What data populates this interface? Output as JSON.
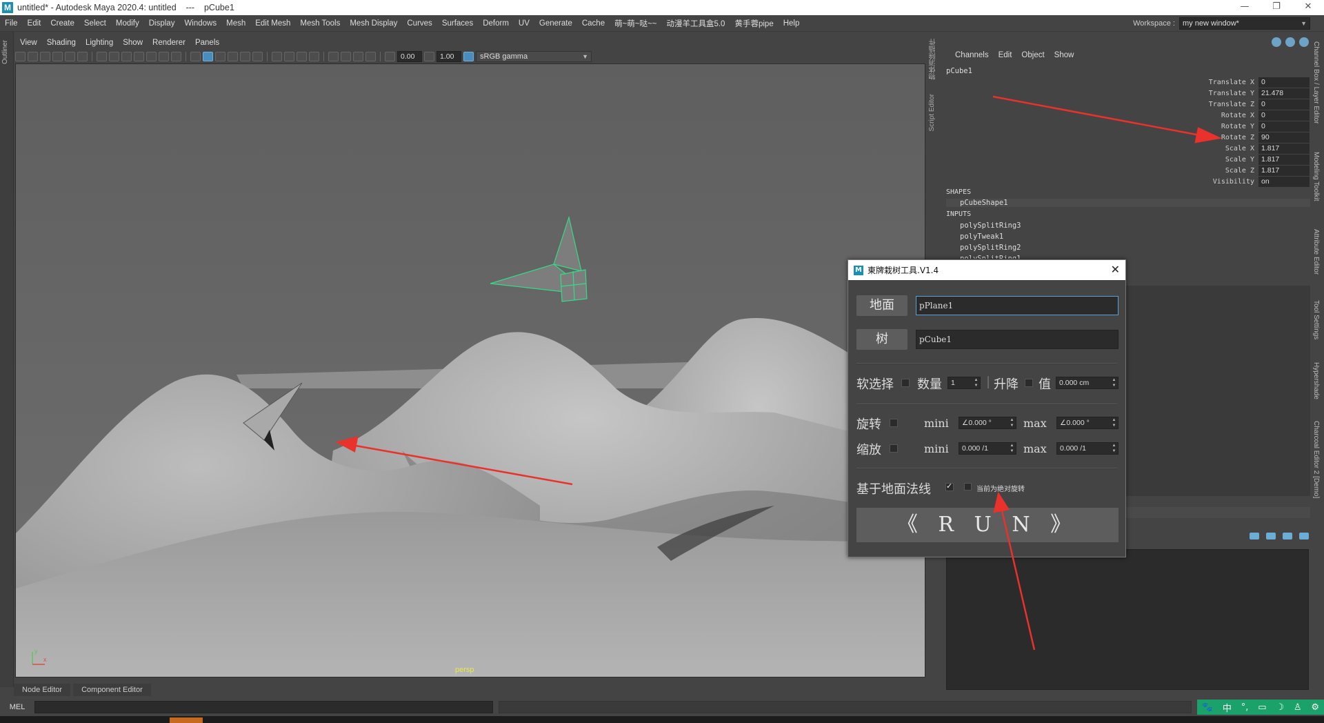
{
  "window": {
    "title": "untitled* - Autodesk Maya 2020.4: untitled    ---    pCube1",
    "controls": [
      "—",
      "❐",
      "✕"
    ]
  },
  "menubar": [
    "File",
    "Edit",
    "Create",
    "Select",
    "Modify",
    "Display",
    "Windows",
    "Mesh",
    "Edit Mesh",
    "Mesh Tools",
    "Mesh Display",
    "Curves",
    "Surfaces",
    "Deform",
    "UV",
    "Generate",
    "Cache",
    "萌~萌~哒~~",
    "动漫羊工具盒5.0",
    "黄手蓉pipe",
    "Help"
  ],
  "workspace": {
    "label": "Workspace :",
    "value": "my new window*"
  },
  "outliner_tab": "Outliner",
  "viewport": {
    "menu": [
      "View",
      "Shading",
      "Lighting",
      "Show",
      "Renderer",
      "Panels"
    ],
    "exposure": "0.00",
    "gamma": "1.00",
    "color_space": "sRGB gamma",
    "camera_label": "persp",
    "axis_x": "x",
    "axis_y": "y"
  },
  "side_tabs_mid": [
    "物体消除插件",
    "Script Editor"
  ],
  "side_tabs_right": [
    "Channel Box / Layer Editor",
    "Modeling Toolkit",
    "Attribute Editor",
    "Tool Settings",
    "Hypershade",
    "Charcoal Editor 2 [Demo]"
  ],
  "channel_box": {
    "menu": [
      "Channels",
      "Edit",
      "Object",
      "Show"
    ],
    "object_name": "pCube1",
    "attributes": [
      {
        "label": "Translate X",
        "value": "0"
      },
      {
        "label": "Translate Y",
        "value": "21.478"
      },
      {
        "label": "Translate Z",
        "value": "0"
      },
      {
        "label": "Rotate X",
        "value": "0"
      },
      {
        "label": "Rotate Y",
        "value": "0"
      },
      {
        "label": "Rotate Z",
        "value": "90"
      },
      {
        "label": "Scale X",
        "value": "1.817"
      },
      {
        "label": "Scale Y",
        "value": "1.817"
      },
      {
        "label": "Scale Z",
        "value": "1.817"
      },
      {
        "label": "Visibility",
        "value": "on"
      }
    ],
    "shapes_header": "SHAPES",
    "shape_node": "pCubeShape1",
    "inputs_header": "INPUTS",
    "input_nodes": [
      "polySplitRing3",
      "polyTweak1",
      "polySplitRing2",
      "polySplitRing1"
    ]
  },
  "bottom_tabs": [
    "Node Editor",
    "Component Editor"
  ],
  "command_line": {
    "label": "MEL"
  },
  "ime_bar": [
    "🐾",
    "中",
    "°,",
    "▭",
    "☽",
    "♙",
    "⚙"
  ],
  "tool_window": {
    "title": "東牌栽树工具.V1.4",
    "ground_label": "地面",
    "ground_value": "pPlane1",
    "tree_label": "树",
    "tree_value": "pCube1",
    "soft_select_label": "软选择",
    "count_label": "数量",
    "count_value": "1",
    "raise_label": "升降",
    "value_label": "值",
    "value_value": "0.000 cm",
    "rotate_label": "旋转",
    "scale_label": "缩放",
    "mini_label": "mini",
    "max_label": "max",
    "rotate_min": "∠0.000 °",
    "rotate_max": "∠0.000 °",
    "scale_min": "0.000 /1",
    "scale_max": "0.000 /1",
    "normal_label": "基于地面法线",
    "absolute_label": "当前为绝对旋转",
    "normal_checked": true,
    "run_label": "《 R U N 》"
  },
  "colors": {
    "accent": "#5aa2d6",
    "selection": "#33dd88",
    "annotation": "#e8322b",
    "viewport_bg": "#676767"
  }
}
